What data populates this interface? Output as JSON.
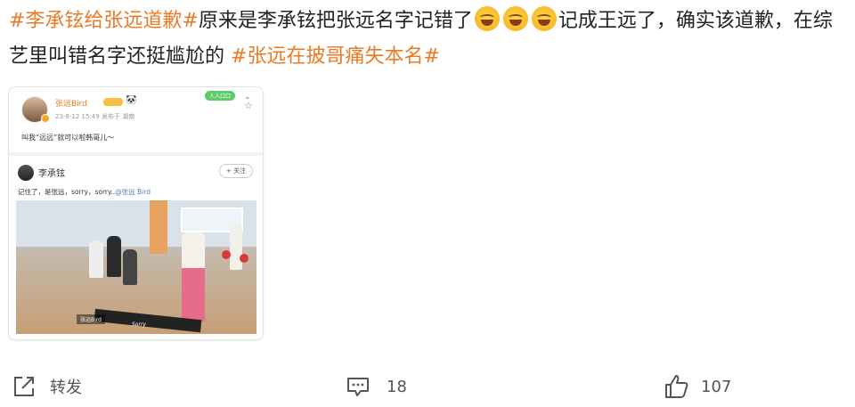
{
  "post": {
    "tag1": "#李承铉给张远道歉#",
    "text_a": "原来是李承铉把张远名字记错了",
    "text_b": "记成王远了，确实该道歉，在综艺里叫错名字还挺尴尬的",
    "tag2": "#张远在披哥痛失本名#",
    "emoji_name": "laugh-cry-emoji"
  },
  "embed": {
    "username": "张远Bird",
    "level_badge": "level-badge",
    "panda": "🐼",
    "meta": "23-8-12 15:49 发布于 湖南",
    "fan_badge": "人人口口",
    "quote": "叫我“远远”就可以啦韩哥儿～",
    "reply_user": "李承铉",
    "follow_label": "+ 关注",
    "reply_text": "记住了，是张远，sorry，sorry..",
    "reply_at": "@张远 Bird",
    "video_caption": "张远Bird",
    "video_caption2": "Sorry"
  },
  "actions": {
    "repost_label": "转发",
    "comment_count": "18",
    "like_count": "107"
  },
  "colors": {
    "tag": "#ea7a26",
    "text": "#222222",
    "muted": "#555555"
  }
}
